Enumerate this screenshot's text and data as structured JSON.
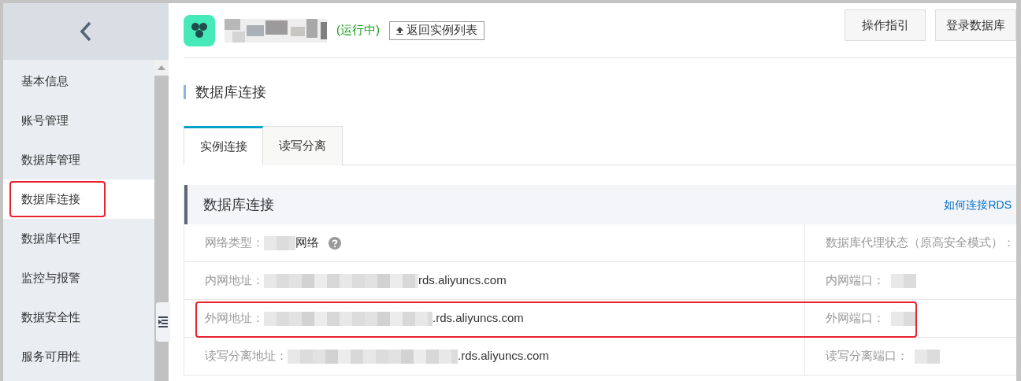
{
  "sidebar": {
    "items": [
      {
        "label": "基本信息",
        "selected": false,
        "highlighted": false
      },
      {
        "label": "账号管理",
        "selected": false,
        "highlighted": false
      },
      {
        "label": "数据库管理",
        "selected": false,
        "highlighted": false
      },
      {
        "label": "数据库连接",
        "selected": true,
        "highlighted": true
      },
      {
        "label": "数据库代理",
        "selected": false,
        "highlighted": false
      },
      {
        "label": "监控与报警",
        "selected": false,
        "highlighted": false
      },
      {
        "label": "数据安全性",
        "selected": false,
        "highlighted": false
      },
      {
        "label": "服务可用性",
        "selected": false,
        "highlighted": false
      }
    ]
  },
  "header": {
    "status": "(运行中)",
    "back_button": "返回实例列表",
    "buttons": [
      "操作指引",
      "登录数据库"
    ]
  },
  "page_title": "数据库连接",
  "tabs": [
    {
      "label": "实例连接",
      "selected": true
    },
    {
      "label": "读写分离",
      "selected": false
    }
  ],
  "panel": {
    "title": "数据库连接",
    "link": "如何连接RDS",
    "rows": [
      {
        "label": "网络类型：",
        "value": "网络",
        "help": true,
        "highlighted": false,
        "right_label": "数据库代理状态（原高安全模式）："
      },
      {
        "label": "内网地址：",
        "value": "rds.aliyuncs.com",
        "help": false,
        "highlighted": false,
        "right_label": "内网端口："
      },
      {
        "label": "外网地址：",
        "value": ".rds.aliyuncs.com",
        "help": false,
        "highlighted": true,
        "right_label": "外网端口："
      },
      {
        "label": "读写分离地址：",
        "value": ".rds.aliyuncs.com",
        "help": false,
        "highlighted": false,
        "right_label": "读写分离端口："
      }
    ]
  }
}
